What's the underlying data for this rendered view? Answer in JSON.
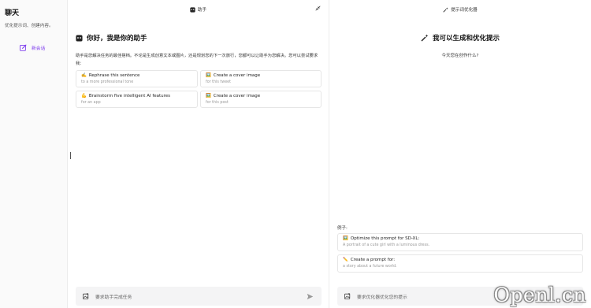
{
  "sidebar": {
    "title": "聊天",
    "subtitle": "优化提示词、创建内容。",
    "new_chat_label": "新会话"
  },
  "assistant": {
    "header_title": "助手",
    "greeting": "你好，我是你的助手",
    "description": "助手是您解决任务的最佳搭档。不论是生成创意文本或图片，还是规划您的下一次旅行，您都可以让助手为您解决。您可以尝试要求我：",
    "cards": [
      {
        "emoji": "✍️",
        "title": "Rephrase this sentence",
        "sub": "to a more professional tone"
      },
      {
        "emoji": "🖼️",
        "title": "Create a cover image",
        "sub": "for this tweet"
      },
      {
        "emoji": "💪",
        "title": "Brainstorm five intelligent AI features",
        "sub": "for an app"
      },
      {
        "emoji": "🖼️",
        "title": "Create a cover image",
        "sub": "for this post"
      }
    ],
    "input_placeholder": "要求助手完成任务"
  },
  "optimizer": {
    "header_title": "提示词优化器",
    "greeting": "我可以生成和优化提示",
    "subtitle": "今天您在创作什么?",
    "examples_label": "例子:",
    "examples": [
      {
        "emoji": "🖼️",
        "title": "Optimize this prompt for SD-XL:",
        "sub": "A portrait of a cute girl with a luminous dress."
      },
      {
        "emoji": "✏️",
        "title": "Create a prompt for:",
        "sub": "a story about a future world."
      }
    ],
    "input_placeholder": "要求优化器优化您的提示"
  },
  "watermark": "Openl.cn",
  "colors": {
    "accent": "#7c3aed",
    "input_bg": "#f4f4f5",
    "border": "#e6e6e6"
  },
  "icons": [
    "edit-icon",
    "bot-icon",
    "magic-wand-icon",
    "collapse-icon",
    "image-icon",
    "send-icon"
  ]
}
